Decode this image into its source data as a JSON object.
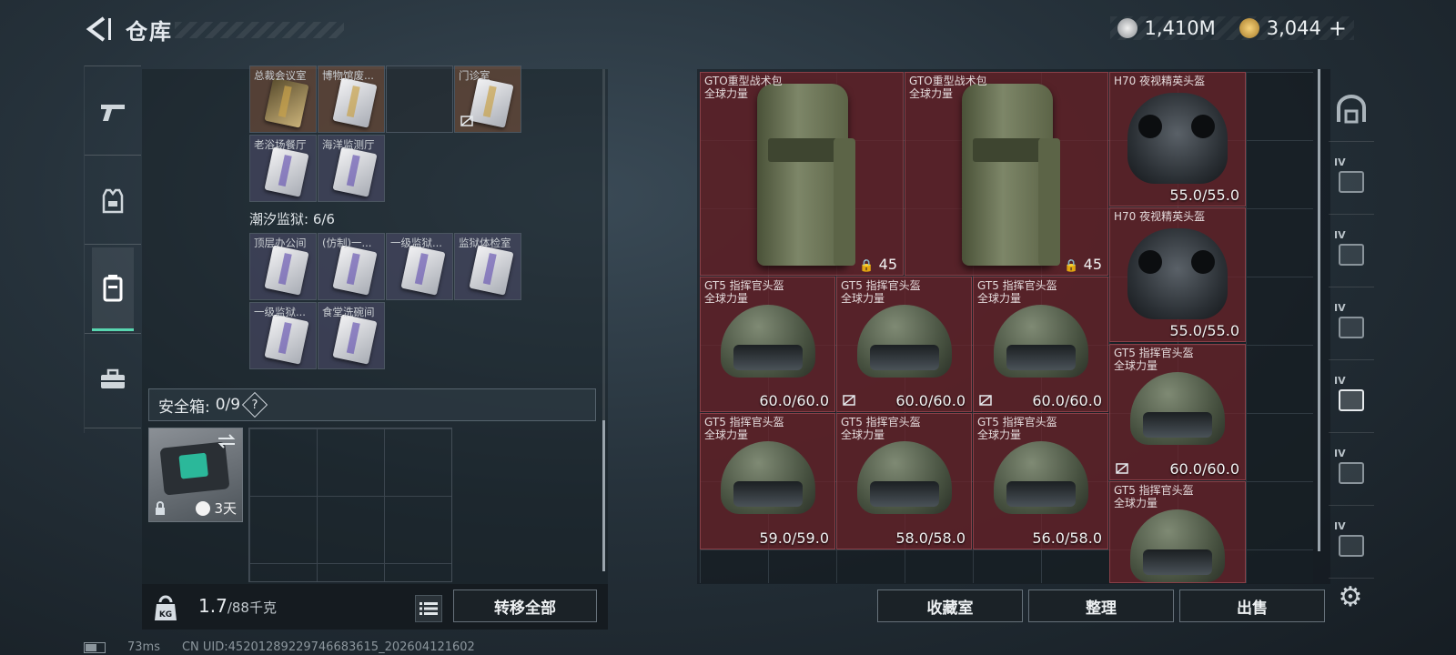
{
  "header": {
    "title": "仓库",
    "currency_silver": "1,410M",
    "currency_gold": "3,044",
    "add_symbol": "+"
  },
  "left_tabs": [
    "weapons",
    "armor",
    "storage",
    "toolbox"
  ],
  "left_panel": {
    "rooms_top": [
      {
        "label": "总裁会议室",
        "style": "orange",
        "card": "gold"
      },
      {
        "label": "博物馆废...",
        "style": "orange",
        "card": "silver"
      },
      {
        "label": "",
        "style": "dark",
        "card": ""
      },
      {
        "label": "门诊室",
        "style": "orange",
        "card": "silver",
        "no_flag": true
      }
    ],
    "rooms_row2": [
      {
        "label": "老浴场餐厅",
        "style": "purple",
        "card": "silver"
      },
      {
        "label": "海洋监测厅",
        "style": "purple",
        "card": "silver"
      }
    ],
    "prison_title": "潮汐监狱: 6/6",
    "prison_row1": [
      {
        "label": "顶层办公间"
      },
      {
        "label": "(仿制)一..."
      },
      {
        "label": "一级监狱..."
      },
      {
        "label": "监狱体检室"
      }
    ],
    "prison_row2": [
      {
        "label": "一级监狱..."
      },
      {
        "label": "食堂洗碗间"
      }
    ],
    "safe_box": {
      "label": "安全箱:",
      "count": "0/9",
      "help": "?",
      "timer": "3天"
    }
  },
  "bottom_left": {
    "weight_value": "1.7",
    "weight_max": "/88千克",
    "kg_label": "KG",
    "transfer_all": "转移全部"
  },
  "right_panel": {
    "items": [
      {
        "kind": "bag",
        "name1": "GTO重型战术包",
        "name2": "全球力量",
        "capacity": "45"
      },
      {
        "kind": "bag",
        "name1": "GTO重型战术包",
        "name2": "全球力量",
        "capacity": "45"
      },
      {
        "kind": "nvg",
        "name1": "H70 夜视精英头盔",
        "name2": "",
        "durability": "55.0/55.0"
      },
      {
        "kind": "nvg",
        "name1": "H70 夜视精英头盔",
        "name2": "",
        "durability": "55.0/55.0"
      },
      {
        "kind": "helmet",
        "name1": "GT5 指挥官头盔",
        "name2": "全球力量",
        "durability": "60.0/60.0"
      },
      {
        "kind": "helmet",
        "name1": "GT5 指挥官头盔",
        "name2": "全球力量",
        "durability": "60.0/60.0",
        "no_flag": true
      },
      {
        "kind": "helmet",
        "name1": "GT5 指挥官头盔",
        "name2": "全球力量",
        "durability": "60.0/60.0",
        "no_flag": true
      },
      {
        "kind": "helmet",
        "name1": "GT5 指挥官头盔",
        "name2": "全球力量",
        "durability": "60.0/60.0",
        "no_flag": true
      },
      {
        "kind": "helmet",
        "name1": "GT5 指挥官头盔",
        "name2": "全球力量",
        "durability": "59.0/59.0"
      },
      {
        "kind": "helmet",
        "name1": "GT5 指挥官头盔",
        "name2": "全球力量",
        "durability": "58.0/58.0"
      },
      {
        "kind": "helmet",
        "name1": "GT5 指挥官头盔",
        "name2": "全球力量",
        "durability": "56.0/58.0"
      },
      {
        "kind": "helmet",
        "name1": "GT5 指挥官头盔",
        "name2": "全球力量",
        "durability": ""
      }
    ]
  },
  "right_tabs": [
    "arch-icon",
    "IV",
    "IV",
    "IV",
    "IV",
    "IV",
    "IV"
  ],
  "bottom_right": {
    "collection": "收藏室",
    "organize": "整理",
    "sell": "出售"
  },
  "status_bar": {
    "ping": "73ms",
    "uid": "CN UID:4520128922974668361​5_202604121602"
  },
  "colors": {
    "accent": "#58d6b0",
    "item_bg": "#6e222a"
  }
}
